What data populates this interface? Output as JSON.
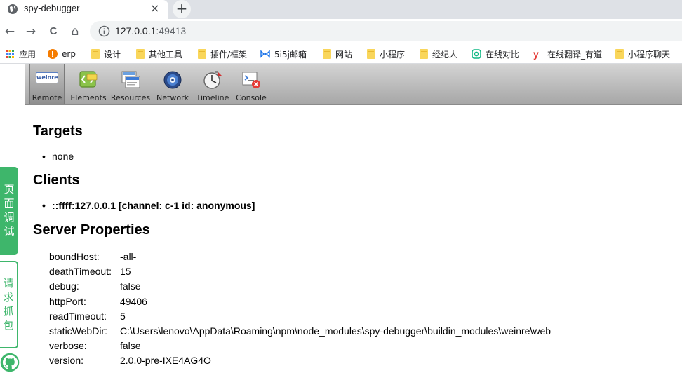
{
  "tab": {
    "title": "spy-debugger",
    "close": "×",
    "new_tab": "+"
  },
  "toolbar": {
    "back": "←",
    "forward": "→",
    "reload": "C",
    "home": "⌂",
    "url_host": "127.0.0.1",
    "url_port": ":49413"
  },
  "bookmarks": [
    {
      "label": "应用",
      "icon": "apps-grid-icon"
    },
    {
      "label": "erp",
      "icon": "erp-icon"
    },
    {
      "label": "设计",
      "icon": "folder-icon"
    },
    {
      "label": "其他工具",
      "icon": "folder-icon"
    },
    {
      "label": "插件/框架",
      "icon": "folder-icon"
    },
    {
      "label": "5i5j邮箱",
      "icon": "mail-icon"
    },
    {
      "label": "网站",
      "icon": "folder-icon"
    },
    {
      "label": "小程序",
      "icon": "folder-icon"
    },
    {
      "label": "经纪人",
      "icon": "folder-icon"
    },
    {
      "label": "在线对比",
      "icon": "compare-icon"
    },
    {
      "label": "在线翻译_有道",
      "icon": "youdao-icon"
    },
    {
      "label": "小程序聊天",
      "icon": "folder-icon"
    }
  ],
  "side": {
    "debug_label": "页面调试",
    "capture_label": "请求抓包"
  },
  "weinre_tabs": [
    {
      "label": "Remote",
      "icon": "weinre-logo-icon",
      "selected": true
    },
    {
      "label": "Elements",
      "icon": "elements-icon"
    },
    {
      "label": "Resources",
      "icon": "resources-icon"
    },
    {
      "label": "Network",
      "icon": "network-icon"
    },
    {
      "label": "Timeline",
      "icon": "timeline-icon"
    },
    {
      "label": "Console",
      "icon": "console-icon"
    }
  ],
  "weinre_logo_text": "weinre",
  "sections": {
    "targets_title": "Targets",
    "targets": [
      "none"
    ],
    "clients_title": "Clients",
    "clients": [
      "::ffff:127.0.0.1 [channel: c-1 id: anonymous]"
    ],
    "server_title": "Server Properties"
  },
  "server_properties": [
    {
      "key": "boundHost:",
      "value": "-all-"
    },
    {
      "key": "deathTimeout:",
      "value": "15"
    },
    {
      "key": "debug:",
      "value": "false"
    },
    {
      "key": "httpPort:",
      "value": "49406"
    },
    {
      "key": "readTimeout:",
      "value": "5"
    },
    {
      "key": "staticWebDir:",
      "value": "C:\\Users\\lenovo\\AppData\\Roaming\\npm\\node_modules\\spy-debugger\\buildin_modules\\weinre\\web"
    },
    {
      "key": "verbose:",
      "value": "false"
    },
    {
      "key": "version:",
      "value": "2.0.0-pre-IXE4AG4O"
    }
  ]
}
